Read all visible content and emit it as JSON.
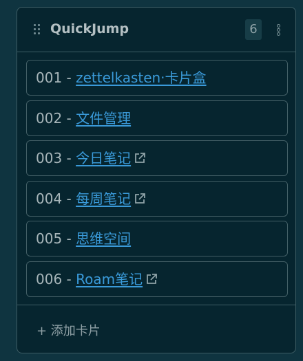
{
  "panel": {
    "title": "QuickJump",
    "count": "6",
    "add_label": "+ 添加卡片"
  },
  "cards": [
    {
      "prefix": "001 - ",
      "link": "zettelkasten·卡片盒",
      "external": false
    },
    {
      "prefix": "002 - ",
      "link": "文件管理",
      "external": false
    },
    {
      "prefix": "003 - ",
      "link": "今日笔记",
      "external": true
    },
    {
      "prefix": "004 - ",
      "link": "每周笔记",
      "external": true
    },
    {
      "prefix": "005 - ",
      "link": "思维空间",
      "external": false
    },
    {
      "prefix": "006 - ",
      "link": "Roam笔记",
      "external": true
    }
  ],
  "icons": {
    "drag": "drag-handle-icon",
    "more": "more-vertical-icon",
    "external": "external-link-icon"
  },
  "colors": {
    "link": "#3a9ad9",
    "panel_bg": "#06252f",
    "page_bg": "#0f3440"
  }
}
